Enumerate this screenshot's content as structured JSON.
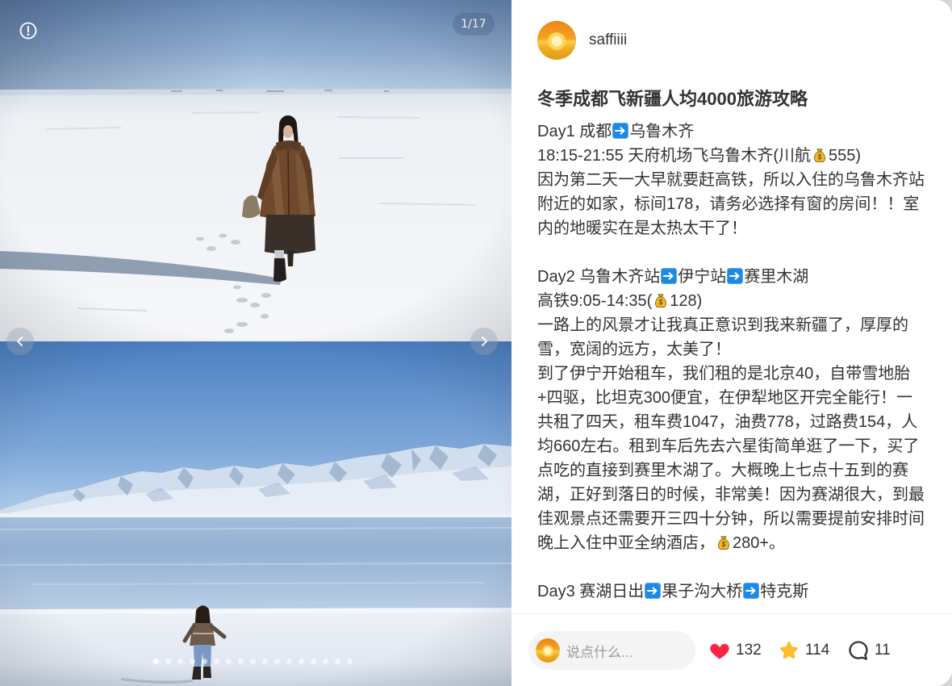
{
  "gallery": {
    "counter": "1/17",
    "dot_count": 17,
    "active_dot": 0
  },
  "author": {
    "name": "saffiiii"
  },
  "note": {
    "title": "冬季成都飞新疆人均4000旅游攻略",
    "lines": [
      [
        {
          "t": "Day1 成都"
        },
        {
          "icon": "arrow-right-icon"
        },
        {
          "t": "乌鲁木齐"
        }
      ],
      [
        {
          "t": "18:15-21:55 天府机场飞乌鲁木齐(川航"
        },
        {
          "icon": "money-bag-icon"
        },
        {
          "t": "555)"
        }
      ],
      [
        {
          "t": "因为第二天一大早就要赶高铁，所以入住的乌鲁木齐站"
        }
      ],
      [
        {
          "t": "附近的如家，标间178，请务必选择有窗的房间！！室"
        }
      ],
      [
        {
          "t": "内的地暖实在是太热太干了！"
        }
      ],
      [],
      [
        {
          "t": "Day2 乌鲁木齐站"
        },
        {
          "icon": "arrow-right-icon"
        },
        {
          "t": "伊宁站"
        },
        {
          "icon": "arrow-right-icon"
        },
        {
          "t": "赛里木湖"
        }
      ],
      [
        {
          "t": "高铁9:05-14:35("
        },
        {
          "icon": "money-bag-icon"
        },
        {
          "t": "128)"
        }
      ],
      [
        {
          "t": "一路上的风景才让我真正意识到我来新疆了，厚厚的"
        }
      ],
      [
        {
          "t": "雪，宽阔的远方，太美了！"
        }
      ],
      [
        {
          "t": "到了伊宁开始租车，我们租的是北京40，自带雪地胎"
        }
      ],
      [
        {
          "t": "+四驱，比坦克300便宜，在伊犁地区开完全能行！一"
        }
      ],
      [
        {
          "t": "共租了四天，租车费1047，油费778，过路费154，人"
        }
      ],
      [
        {
          "t": "均660左右。租到车后先去六星街简单逛了一下，买了"
        }
      ],
      [
        {
          "t": "点吃的直接到赛里木湖了。大概晚上七点十五到的赛"
        }
      ],
      [
        {
          "t": "湖，正好到落日的时候，非常美！因为赛湖很大，到最"
        }
      ],
      [
        {
          "t": "佳观景点还需要开三四十分钟，所以需要提前安排时间"
        }
      ],
      [
        {
          "t": "晚上入住中亚全纳酒店，"
        },
        {
          "icon": "money-bag-icon"
        },
        {
          "t": "280+。"
        }
      ],
      [],
      [
        {
          "t": "Day3 赛湖日出"
        },
        {
          "icon": "arrow-right-icon"
        },
        {
          "t": "果子沟大桥"
        },
        {
          "icon": "arrow-right-icon"
        },
        {
          "t": "特克斯"
        }
      ]
    ]
  },
  "footer": {
    "comment_placeholder": "说点什么...",
    "like_count": "132",
    "collect_count": "114",
    "comment_count": "11"
  },
  "icons": {
    "info": "info-icon",
    "prev": "chevron-left-icon",
    "next": "chevron-right-icon",
    "like": "heart-icon",
    "collect": "star-icon",
    "comment": "comment-icon",
    "route_arrow": "arrow-right-icon",
    "price": "money-bag-icon"
  },
  "colors": {
    "like": "#ff2442",
    "collect": "#fdbc2c",
    "text": "#333333",
    "arrow_emoji": "#1e88e5"
  }
}
